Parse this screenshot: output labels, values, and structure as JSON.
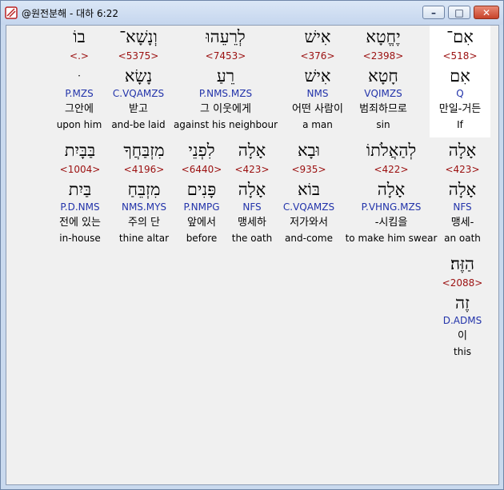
{
  "window": {
    "title": "@원전분해 - 대하 6:22"
  },
  "rows": [
    [
      {
        "heb": "אִם־",
        "strong": "<518>",
        "lemma": "אִם",
        "morph": "Q",
        "kor": "만일-거든",
        "eng": "If",
        "selected": true
      },
      {
        "heb": "יֶחֱטָא",
        "strong": "<2398>",
        "lemma": "חָטָא",
        "morph": "VQIMZS",
        "kor": "범죄하므로",
        "eng": "sin"
      },
      {
        "heb": "אִישׁ",
        "strong": "<376>",
        "lemma": "אִישׁ",
        "morph": "NMS",
        "kor": "어떤 사람이",
        "eng": "a man"
      },
      {
        "heb": "לְרֵעֵהוּ",
        "strong": "<7453>",
        "lemma": "רֵעַ",
        "morph": "P.NMS.MZS",
        "kor": "그 이웃에게",
        "eng": "against his neighbour"
      },
      {
        "heb": "וְנָשָׁא־",
        "strong": "<5375>",
        "lemma": "נָשָׂא",
        "morph": "C.VQAMZS",
        "kor": "받고",
        "eng": "and-be laid"
      },
      {
        "heb": "בוֹ",
        "strong": "<.>",
        "lemma": "ּ",
        "morph": "P.MZS",
        "kor": "그안에",
        "eng": "upon him"
      }
    ],
    [
      {
        "heb": "אָלָה",
        "strong": "<423>",
        "lemma": "אָלָה",
        "morph": "NFS",
        "kor": "맹세-",
        "eng": "an oath"
      },
      {
        "heb": "לְהַאֲלֹתוֹ",
        "strong": "<422>",
        "lemma": "אָלָה",
        "morph": "P.VHNG.MZS",
        "kor": "-시킴을",
        "eng": "to make him swear"
      },
      {
        "heb": "וּבָא",
        "strong": "<935>",
        "lemma": "בּוֹא",
        "morph": "C.VQAMZS",
        "kor": "저가와서",
        "eng": "and-come"
      },
      {
        "heb": "אָלָה",
        "strong": "<423>",
        "lemma": "אָלָה",
        "morph": "NFS",
        "kor": "맹세하",
        "eng": "the oath"
      },
      {
        "heb": "לִפְנֵי",
        "strong": "<6440>",
        "lemma": "פָּנִים",
        "morph": "P.NMPG",
        "kor": "앞에서",
        "eng": "before"
      },
      {
        "heb": "מִזְבַּחֲךָ",
        "strong": "<4196>",
        "lemma": "מִזְבֵּחַ",
        "morph": "NMS.MYS",
        "kor": "주의 단",
        "eng": "thine altar"
      },
      {
        "heb": "בַּבָּיִת",
        "strong": "<1004>",
        "lemma": "בַּיִת",
        "morph": "P.D.NMS",
        "kor": "전에 있는",
        "eng": "in-house"
      }
    ],
    [
      {
        "heb": "הַזֶּה׃",
        "strong": "<2088>",
        "lemma": "זֶה",
        "morph": "D.ADMS",
        "kor": "이",
        "eng": "this"
      }
    ]
  ]
}
